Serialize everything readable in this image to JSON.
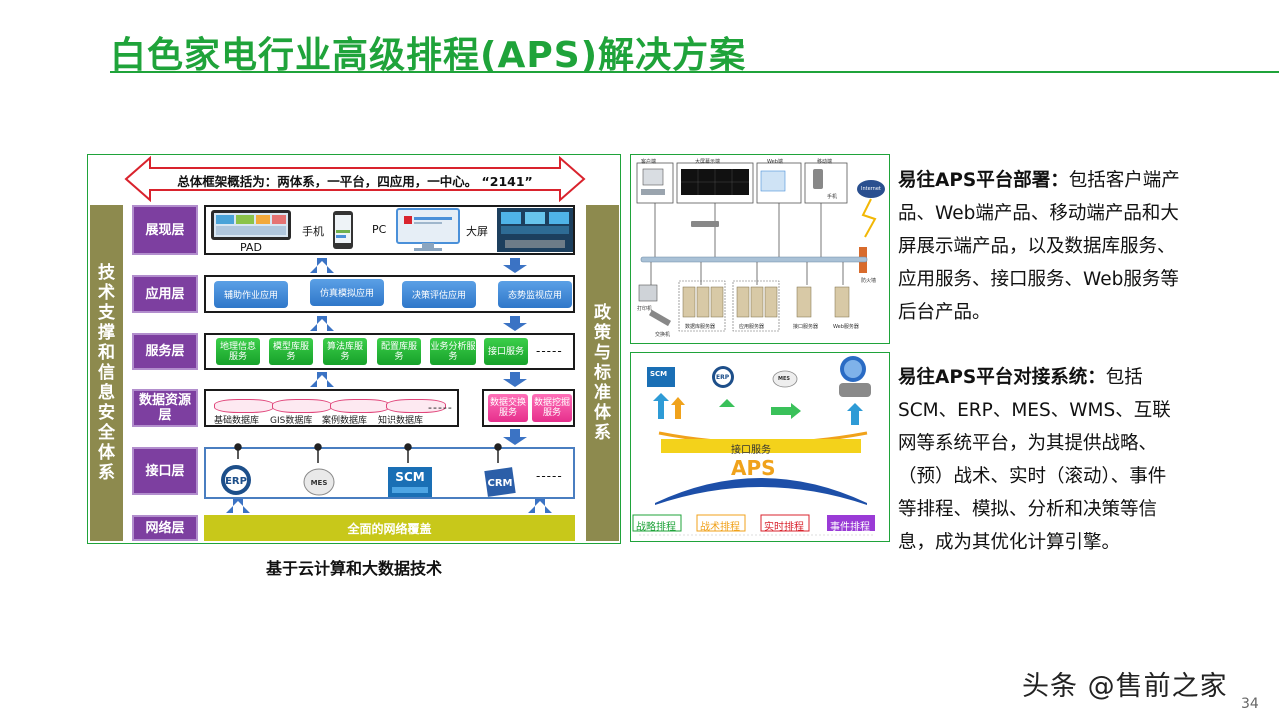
{
  "title": "白色家电行业高级排程(APS)解决方案",
  "architecture": {
    "banner": "总体框架概括为：两体系，一平台，四应用，一中心。 “2141”",
    "left_column": "技术支撑和信息安全体系",
    "right_column": "政策与标准体系",
    "layers": {
      "presentation": "展现层",
      "application": "应用层",
      "service": "服务层",
      "data": "数据资源层",
      "interface": "接口层",
      "network": "网络层"
    },
    "devices": {
      "pad": "PAD",
      "phone": "手机",
      "pc": "PC",
      "screen": "大屏"
    },
    "apps": [
      "辅助作业应用",
      "仿真模拟应用",
      "决策评估应用",
      "态势监视应用"
    ],
    "services": [
      "地理信息服务",
      "模型库服务",
      "算法库服务",
      "配置库服务",
      "业务分析服务",
      "接口服务"
    ],
    "databases": [
      "基础数据库",
      "GIS数据库",
      "案例数据库",
      "知识数据库"
    ],
    "data_services": [
      "数据交换服务",
      "数据挖掘服务"
    ],
    "interfaces": [
      "ERP",
      "MES",
      "SCM",
      "CRM"
    ],
    "dashes": "-----",
    "network": "全面的网络覆盖"
  },
  "caption": "基于云计算和大数据技术",
  "deploy_panel": {
    "labels": [
      "客户端",
      "大屏幕示端",
      "Web端",
      "移动端",
      "手机",
      "Internet",
      "防火墙",
      "打印机",
      "交换机",
      "数据库服务器",
      "应用服务器",
      "接口服务器",
      "Web服务器"
    ]
  },
  "integration_panel": {
    "top_labels": [
      "SCM",
      "ERP",
      "MES"
    ],
    "interface_band": "接口服务",
    "core": "APS",
    "tags": [
      "战略排程",
      "战术排程",
      "实时排程",
      "事件排程"
    ]
  },
  "paragraphs": [
    {
      "lead": "易往APS平台部署：",
      "body": "包括客户端产品、Web端产品、移动端产品和大屏展示端产品，以及数据库服务、应用服务、接口服务、Web服务等后台产品。"
    },
    {
      "lead": "易往APS平台对接系统：",
      "body": "包括SCM、ERP、MES、WMS、互联网等系统平台，为其提供战略、（预）战术、实时（滚动）、事件等排程、模拟、分析和决策等信息，成为其优化计算引擎。"
    }
  ],
  "watermark": "头条 @售前之家",
  "page_number": "34",
  "colors": {
    "accent_green": "#1fa33a",
    "layer_purple": "#7d3fa0",
    "side_olive": "#8d8a4e",
    "banner_red": "#d9232d"
  }
}
